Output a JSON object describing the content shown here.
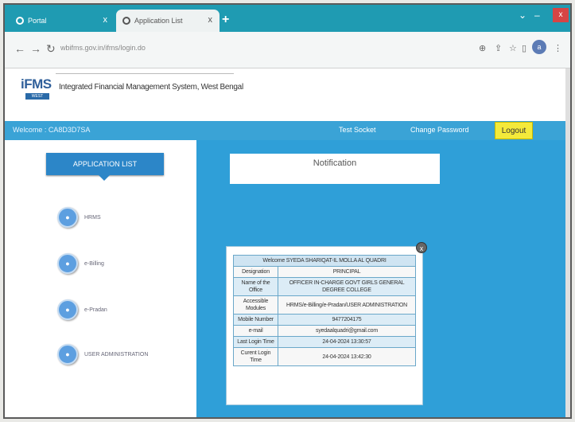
{
  "browser": {
    "tabs": [
      {
        "label": "Portal"
      },
      {
        "label": "Application List"
      }
    ],
    "address": "wbifms.gov.in/ifms/login.do",
    "new_tab_glyph": "+",
    "close_glyph": "x",
    "profile_initial": "a"
  },
  "header": {
    "logo_text": "iFMS",
    "logo_sub": "WEST BENGAL",
    "system_name": "Integrated Financial Management System, West Bengal"
  },
  "topbar": {
    "welcome": "Welcome : CA8D3D7SA",
    "test_socket": "Test Socket",
    "change_password": "Change Password",
    "logout": "Logout"
  },
  "sidebar": {
    "heading": "APPLICATION LIST",
    "items": [
      {
        "label": "HRMS"
      },
      {
        "label": "e-Billing"
      },
      {
        "label": "e-Pradan"
      },
      {
        "label": "USER ADMINISTRATION"
      }
    ]
  },
  "main": {
    "notification_title": "Notification",
    "popup": {
      "close": "x",
      "welcome_row": "Welcome  SYEDA SHARIQAT-IL MOLLA AL QUADRI",
      "rows": [
        {
          "label": "Designation",
          "value": "PRINCIPAL"
        },
        {
          "label": "Name of the Office",
          "value": "OFFICER IN-CHARGE GOVT GIRLS GENERAL DEGREE COLLEGE"
        },
        {
          "label": "Accessible Modules",
          "value": "HRMS/e-Billing/e-Pradan/USER ADMINISTRATION"
        },
        {
          "label": "Mobile Number",
          "value": "9477204175"
        },
        {
          "label": "e-mail",
          "value": "syedaalquadri@gmail.com"
        },
        {
          "label": "Last Login Time",
          "value": "24-04-2024 13:30:57"
        },
        {
          "label": "Curent Login Time",
          "value": "24-04-2024 13:42:30"
        }
      ]
    }
  },
  "colors": {
    "tab_strip": "#1f9bb2",
    "blue_bar": "#3aa3d6",
    "content_bg": "#2f9fd8",
    "logout": "#f4ea3a"
  }
}
